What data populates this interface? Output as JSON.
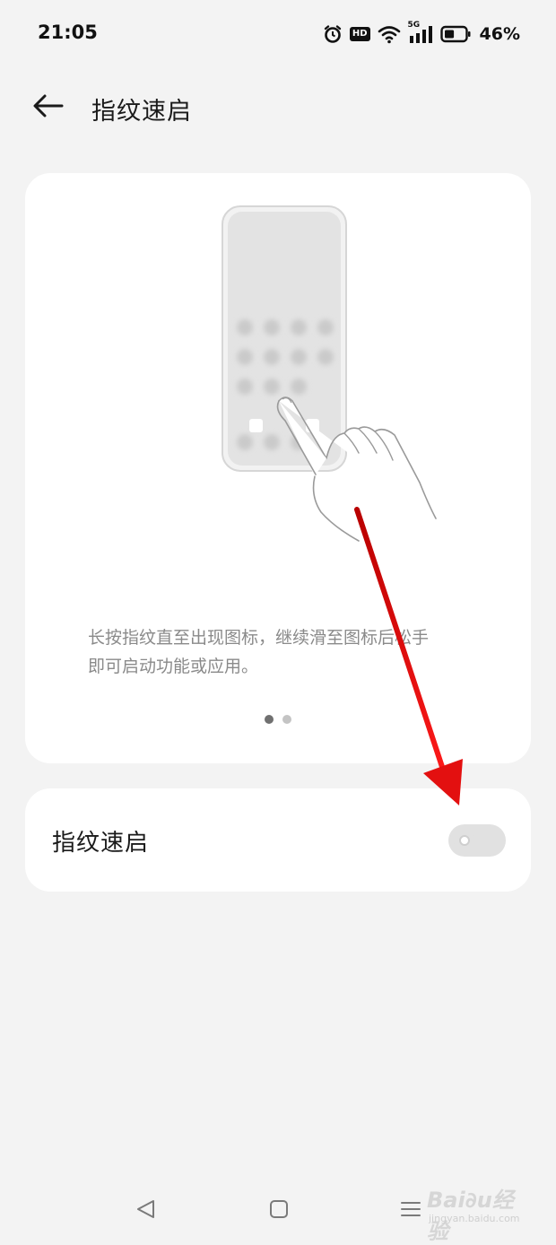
{
  "status_bar": {
    "time": "21:05",
    "hd_badge": "HD",
    "network": "5G",
    "battery_percent": "46%",
    "battery_level": 0.46,
    "icons": [
      "alarm-icon",
      "hd-icon",
      "wifi-icon",
      "signal-5g-icon",
      "battery-icon"
    ]
  },
  "header": {
    "back_icon": "arrow-left-icon",
    "title": "指纹速启"
  },
  "illustration_card": {
    "description_line1": "长按指纹直至出现图标，继续滑至图标后松手",
    "description_line2": "即可启动功能或应用。",
    "page_indicator": {
      "count": 2,
      "active_index": 0
    }
  },
  "setting": {
    "label": "指纹速启",
    "enabled": false
  },
  "navigation_bar": {
    "icons": [
      "nav-back-icon",
      "nav-home-icon",
      "nav-recents-icon"
    ]
  },
  "watermark": {
    "main": "Bai∂u经验",
    "sub": "jingyan.baidu.com"
  },
  "colors": {
    "background": "#f3f3f3",
    "card": "#ffffff",
    "annotation_arrow": "#e31010",
    "toggle_off": "#e1e1e1",
    "secondary_text": "#8a8a8a"
  }
}
